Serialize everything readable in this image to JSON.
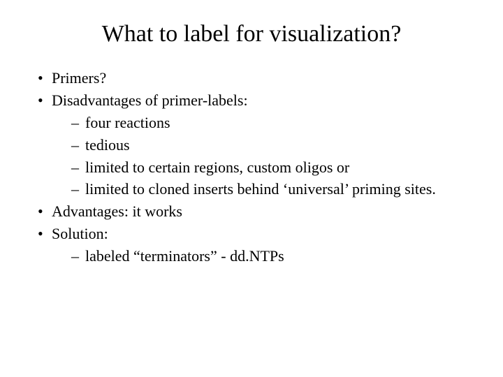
{
  "title": "What to label for visualization?",
  "bullets": [
    {
      "text": "Primers?"
    },
    {
      "text": "Disadvantages of primer-labels:",
      "sub": [
        "four reactions",
        "tedious",
        "limited to certain regions, custom oligos or",
        "limited to cloned inserts behind ‘universal’ priming sites."
      ]
    },
    {
      "text": "Advantages: it works"
    },
    {
      "text": "Solution:",
      "sub": [
        "labeled “terminators” - dd.NTPs"
      ]
    }
  ]
}
